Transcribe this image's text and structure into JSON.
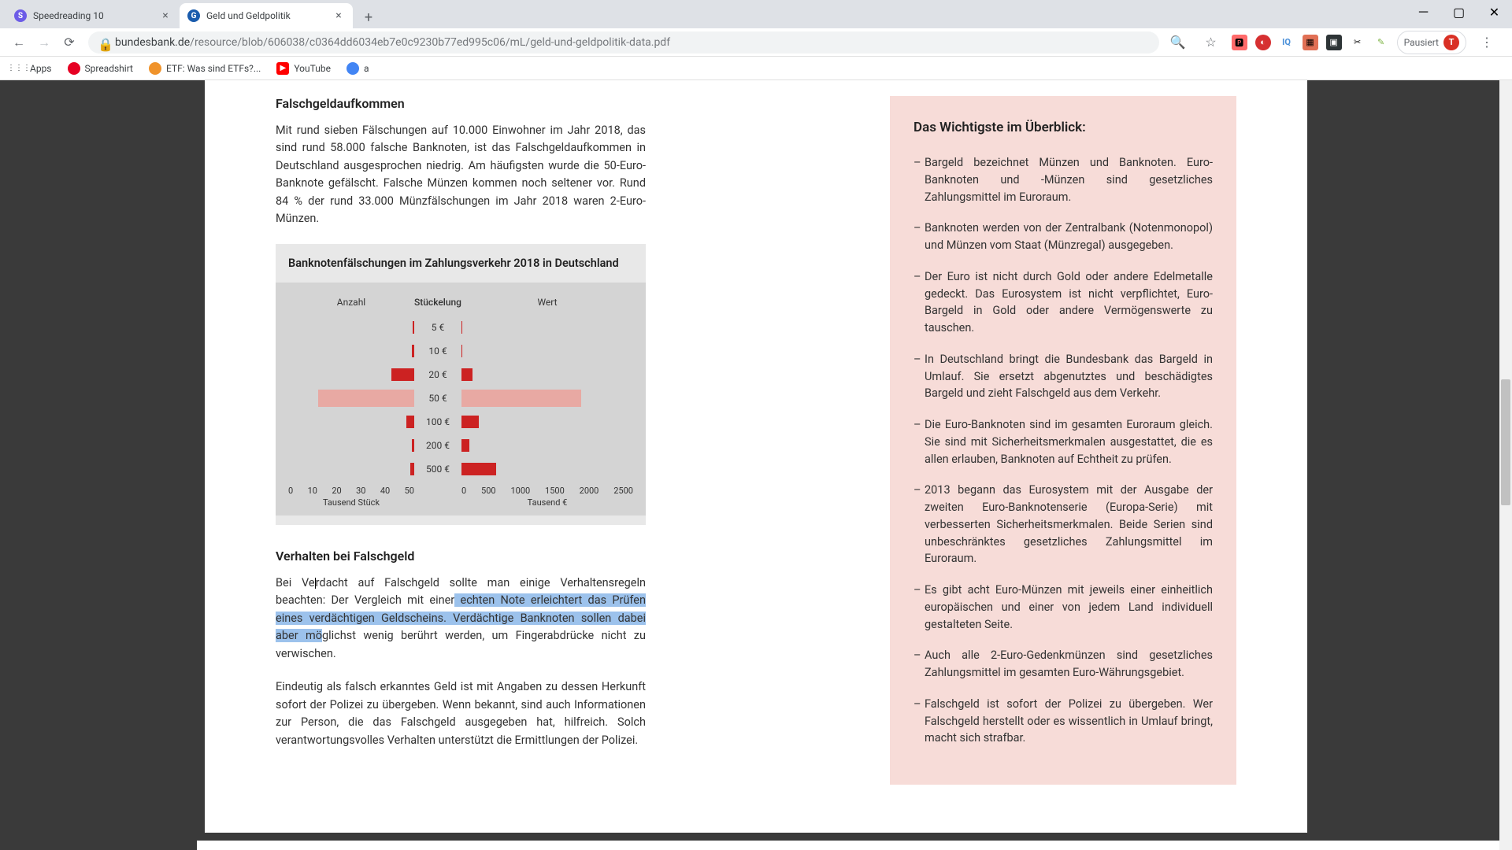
{
  "window": {
    "tabs": [
      {
        "title": "Speedreading 10",
        "favicon_letter": "S",
        "favicon_color": "#6c5ce7"
      },
      {
        "title": "Geld und Geldpolitik",
        "favicon_letter": "G",
        "favicon_color": "#1a5cad"
      }
    ],
    "minimize": "─",
    "maximize": "▢",
    "close": "✕",
    "newtab": "+"
  },
  "addr": {
    "url_host": "bundesbank.de",
    "url_path": "/resource/blob/606038/c0364dd6034eb7e0c9230b77ed995c06/mL/geld-und-geldpolitik-data.pdf",
    "profile_label": "Pausiert",
    "profile_initial": "T"
  },
  "bookmarks": [
    {
      "label": "Apps",
      "color": "#5f6368"
    },
    {
      "label": "Spreadshirt",
      "color": "#e60023"
    },
    {
      "label": "ETF: Was sind ETFs?...",
      "color": "#f0932b"
    },
    {
      "label": "YouTube",
      "color": "#ff0000"
    },
    {
      "label": "a",
      "color": "#4285f4"
    }
  ],
  "doc": {
    "left": {
      "h1": "Falschgeldaufkommen",
      "p1": "Mit rund sieben Fälschungen auf 10.000 Einwohner im Jahr 2018, das sind rund 58.000 falsche Banknoten, ist das Falschgeldaufkommen in Deutschland ausgesprochen niedrig. Am häufigsten wurde die 50-Euro-Banknote ge­fälscht. Falsche Münzen kommen noch seltener vor. Rund 84 % der rund 33.000 Münzfälschungen im Jahr 2018 waren 2-Euro-Münzen.",
      "h2": "Verhalten bei Falschgeld",
      "p2_pre": "Bei Ve",
      "p2_cursor_after": "rdacht auf Falschgeld sollte man einige Verhaltensregeln beachten: Der Vergleich mit einer",
      "p2_hl": " echten Note erleichtert das Prüfen eines verdächtigen Geldscheins. Verdächtige Banknoten sollen dabei aber mö",
      "p2_post": "glichst wenig be­rührt werden, um Fingerabdrücke nicht zu verwischen.",
      "p3": "Eindeutig als falsch erkanntes Geld ist mit Angaben zu dessen Herkunft sofort der Polizei zu übergeben. Wenn bekannt, sind auch Informationen zur Person, die das Falschgeld ausgegeben hat, hilfreich. Solch verantwortungsvolles Ver­halten unterstützt die Ermittlungen der Polizei."
    },
    "chart": {
      "title": "Banknotenfälschungen im Zahlungsverkehr 2018 in Deutschland",
      "hdr_left": "Anzahl",
      "hdr_mid": "Stückelung",
      "hdr_right": "Wert",
      "denoms": [
        "5 €",
        "10 €",
        "20 €",
        "50 €",
        "100 €",
        "200 €",
        "500 €"
      ],
      "axis_left_ticks": [
        "50",
        "40",
        "30",
        "20",
        "10",
        "0"
      ],
      "axis_right_ticks": [
        "0",
        "500",
        "1000",
        "1500",
        "2000",
        "2500"
      ],
      "axis_left_label": "Tausend Stück",
      "axis_right_label": "Tausend €"
    },
    "summary": {
      "title": "Das Wichtigste im Überblick:",
      "items": [
        "Bargeld bezeichnet Münzen und Banknoten. Euro-Banknoten und -Münzen sind gesetzliches Zahlungsmittel im Euroraum.",
        "Banknoten werden von der Zentralbank (Notenmonopol) und Münzen vom Staat (Münzregal) ausgegeben.",
        "Der Euro ist nicht durch Gold oder andere Edelmetalle gedeckt. Das Eurosystem ist nicht verpflichtet, Euro-Bargeld in Gold oder andere Vermögenswerte zu tauschen.",
        "In Deutschland bringt die Bundesbank das Bargeld in Umlauf. Sie ersetzt abgenutztes und beschädigtes Bargeld und zieht Falschgeld aus dem Verkehr.",
        "Die Euro-Banknoten sind im gesamten Euroraum gleich. Sie sind mit Sicherheitsmerkmalen ausgestattet, die es allen erlauben, Bank­noten auf Echtheit zu prüfen.",
        "2013 begann das Eurosystem mit der Ausgabe der zweiten Euro-Banknotenserie (Europa-Serie) mit verbesserten Sicherheitsmerk­malen. Beide Serien sind unbeschränktes gesetzliches Zahlungs­mittel im Euroraum.",
        "Es gibt acht Euro-Münzen mit jeweils einer einheitlich europäischen und einer von jedem Land individuell gestalteten Seite.",
        "Auch alle 2-Euro-Gedenkmünzen sind gesetzliches Zahlungsmittel im gesamten Euro-Währungsgebiet.",
        "Falschgeld ist sofort der Polizei zu übergeben. Wer Falschgeld her­stellt oder es wissentlich in Umlauf bringt, macht sich strafbar."
      ]
    }
  },
  "chart_data": {
    "type": "bar",
    "title": "Banknotenfälschungen im Zahlungsverkehr 2018 in Deutschland",
    "categories": [
      "5 €",
      "10 €",
      "20 €",
      "50 €",
      "100 €",
      "200 €",
      "500 €"
    ],
    "series": [
      {
        "name": "Anzahl (Tausend Stück)",
        "values": [
          0.5,
          1,
          9,
          38,
          3,
          1,
          1.5
        ]
      },
      {
        "name": "Wert (Tausend €)",
        "values": [
          5,
          15,
          170,
          1900,
          280,
          120,
          550
        ]
      }
    ],
    "xlabel_left": "Tausend Stück",
    "xlabel_right": "Tausend €",
    "xlim_left": [
      0,
      50
    ],
    "xlim_right": [
      0,
      2500
    ],
    "highlight_category": "50 €"
  }
}
